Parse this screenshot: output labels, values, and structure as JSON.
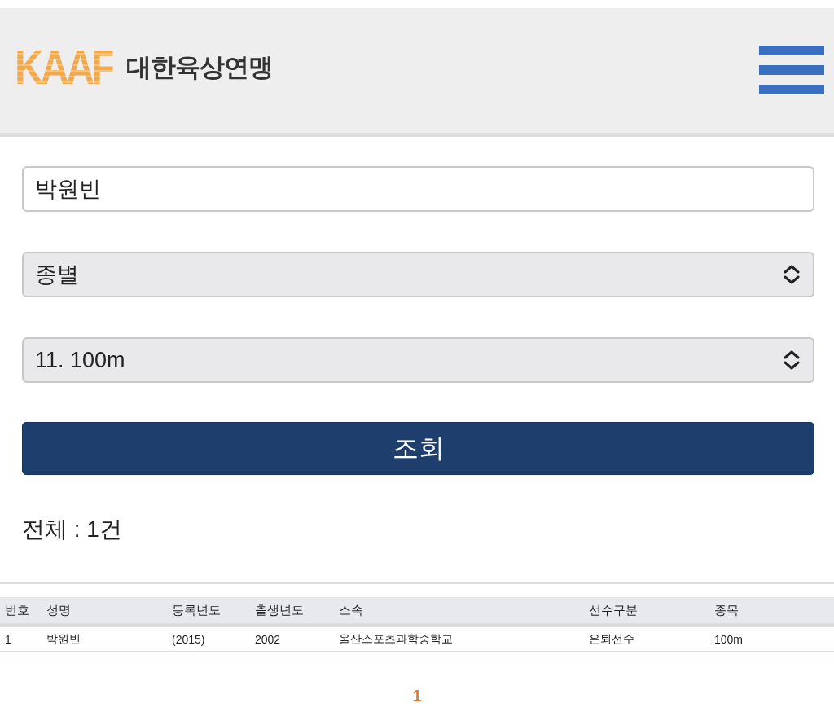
{
  "header": {
    "logo_text": "KAAF",
    "org_name": "대한육상연맹"
  },
  "search_form": {
    "name_field": {
      "value": "박원빈"
    },
    "selects": [
      {
        "value": "종별"
      },
      {
        "value": "11. 100m"
      }
    ],
    "submit_button": "조회"
  },
  "result_count": "전체 : 1건",
  "table": {
    "columns": [
      "번호",
      "성명",
      "등록년도",
      "출생년도",
      "소속",
      "선수구분",
      "종목"
    ],
    "rows": [
      [
        "1",
        "박원빈",
        "(2015)",
        "2002",
        "울산스포츠과학중학교",
        "은퇴선수",
        "100m"
      ]
    ]
  },
  "pagination": [
    {
      "label": "1",
      "selected": true
    }
  ]
}
